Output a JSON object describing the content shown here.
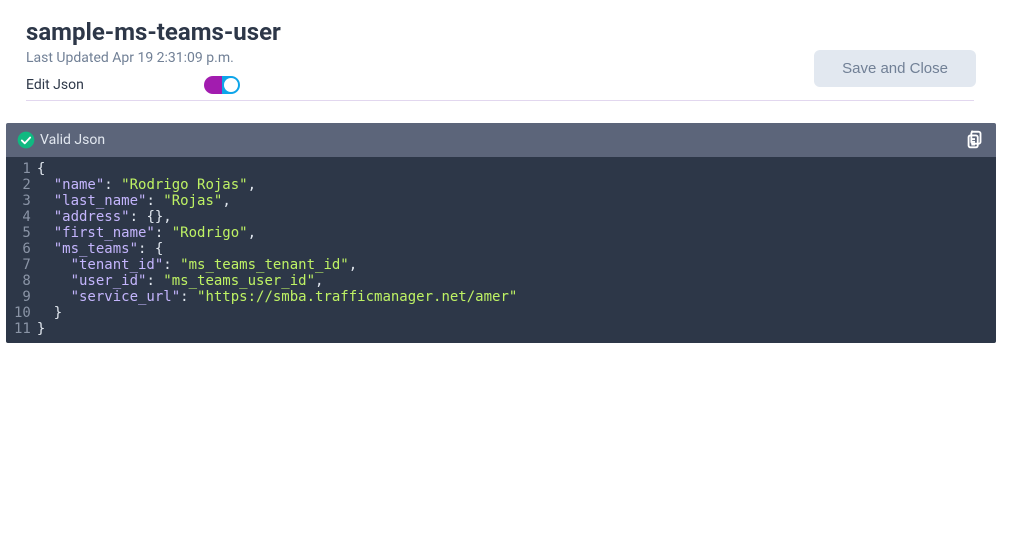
{
  "header": {
    "title": "sample-ms-teams-user",
    "subtitle": "Last Updated Apr 19 2:31:09 p.m.",
    "save_label": "Save and Close"
  },
  "toggle": {
    "label": "Edit Json",
    "on": true
  },
  "editor": {
    "status": "Valid Json",
    "line_numbers": [
      "1",
      "2",
      "3",
      "4",
      "5",
      "6",
      "7",
      "8",
      "9",
      "10",
      "11"
    ],
    "lines": [
      [
        {
          "t": "brace",
          "v": "{"
        }
      ],
      [
        {
          "t": "indent",
          "v": "  "
        },
        {
          "t": "key",
          "v": "\"name\""
        },
        {
          "t": "punc",
          "v": ": "
        },
        {
          "t": "str",
          "v": "\"Rodrigo Rojas\""
        },
        {
          "t": "punc",
          "v": ","
        }
      ],
      [
        {
          "t": "indent",
          "v": "  "
        },
        {
          "t": "key",
          "v": "\"last_name\""
        },
        {
          "t": "punc",
          "v": ": "
        },
        {
          "t": "str",
          "v": "\"Rojas\""
        },
        {
          "t": "punc",
          "v": ","
        }
      ],
      [
        {
          "t": "indent",
          "v": "  "
        },
        {
          "t": "key",
          "v": "\"address\""
        },
        {
          "t": "punc",
          "v": ": "
        },
        {
          "t": "brace",
          "v": "{}"
        },
        {
          "t": "punc",
          "v": ","
        }
      ],
      [
        {
          "t": "indent",
          "v": "  "
        },
        {
          "t": "key",
          "v": "\"first_name\""
        },
        {
          "t": "punc",
          "v": ": "
        },
        {
          "t": "str",
          "v": "\"Rodrigo\""
        },
        {
          "t": "punc",
          "v": ","
        }
      ],
      [
        {
          "t": "indent",
          "v": "  "
        },
        {
          "t": "key",
          "v": "\"ms_teams\""
        },
        {
          "t": "punc",
          "v": ": "
        },
        {
          "t": "brace",
          "v": "{"
        }
      ],
      [
        {
          "t": "indent",
          "v": "    "
        },
        {
          "t": "key",
          "v": "\"tenant_id\""
        },
        {
          "t": "punc",
          "v": ": "
        },
        {
          "t": "str",
          "v": "\"ms_teams_tenant_id\""
        },
        {
          "t": "punc",
          "v": ","
        }
      ],
      [
        {
          "t": "indent",
          "v": "    "
        },
        {
          "t": "key",
          "v": "\"user_id\""
        },
        {
          "t": "punc",
          "v": ": "
        },
        {
          "t": "str",
          "v": "\"ms_teams_user_id\""
        },
        {
          "t": "punc",
          "v": ","
        }
      ],
      [
        {
          "t": "indent",
          "v": "    "
        },
        {
          "t": "key",
          "v": "\"service_url\""
        },
        {
          "t": "punc",
          "v": ": "
        },
        {
          "t": "str",
          "v": "\"https://smba.trafficmanager.net/amer\""
        }
      ],
      [
        {
          "t": "indent",
          "v": "  "
        },
        {
          "t": "brace",
          "v": "}"
        }
      ],
      [
        {
          "t": "brace",
          "v": "}"
        }
      ]
    ]
  }
}
